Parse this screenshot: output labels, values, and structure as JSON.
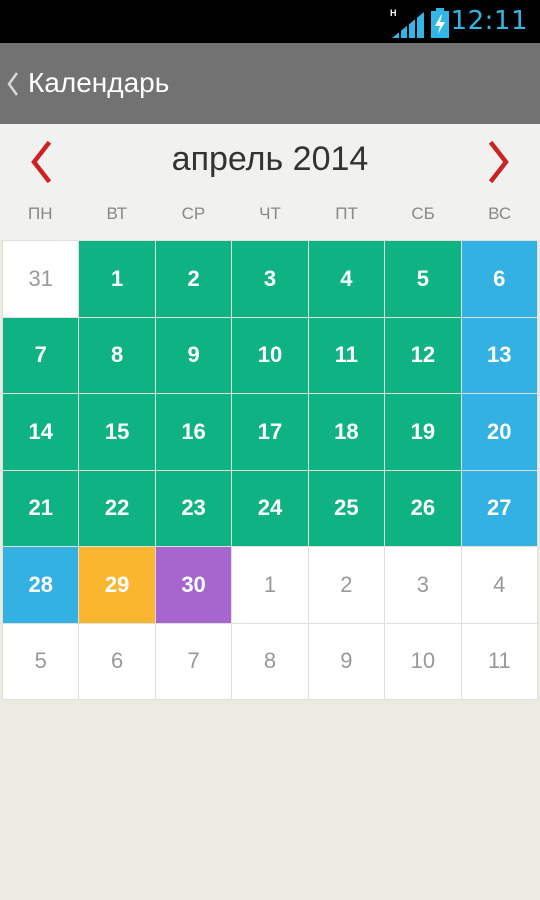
{
  "status_bar": {
    "time": "12:11",
    "network_type": "H",
    "signal_icon": "signal-bars-icon",
    "battery_icon": "battery-charging-icon",
    "accent_color": "#33b5e5"
  },
  "action_bar": {
    "back_icon": "chevron-left-icon",
    "title": "Календарь"
  },
  "calendar": {
    "month_title": "апрель 2014",
    "prev_icon": "chevron-left-icon",
    "next_icon": "chevron-right-icon",
    "nav_color": "#cc2222",
    "weekdays": [
      "ПН",
      "ВТ",
      "СР",
      "ЧТ",
      "ПТ",
      "СБ",
      "ВС"
    ],
    "colors": {
      "green": "#0fb383",
      "blue": "#33b1e2",
      "orange": "#fbb630",
      "purple": "#a766cd",
      "out": "#ffffff"
    },
    "days": [
      {
        "label": "31",
        "style": "out"
      },
      {
        "label": "1",
        "style": "green"
      },
      {
        "label": "2",
        "style": "green"
      },
      {
        "label": "3",
        "style": "green"
      },
      {
        "label": "4",
        "style": "green"
      },
      {
        "label": "5",
        "style": "green"
      },
      {
        "label": "6",
        "style": "blue"
      },
      {
        "label": "7",
        "style": "green"
      },
      {
        "label": "8",
        "style": "green"
      },
      {
        "label": "9",
        "style": "green"
      },
      {
        "label": "10",
        "style": "green"
      },
      {
        "label": "11",
        "style": "green"
      },
      {
        "label": "12",
        "style": "green"
      },
      {
        "label": "13",
        "style": "blue"
      },
      {
        "label": "14",
        "style": "green"
      },
      {
        "label": "15",
        "style": "green"
      },
      {
        "label": "16",
        "style": "green"
      },
      {
        "label": "17",
        "style": "green"
      },
      {
        "label": "18",
        "style": "green"
      },
      {
        "label": "19",
        "style": "green"
      },
      {
        "label": "20",
        "style": "blue"
      },
      {
        "label": "21",
        "style": "green"
      },
      {
        "label": "22",
        "style": "green"
      },
      {
        "label": "23",
        "style": "green"
      },
      {
        "label": "24",
        "style": "green"
      },
      {
        "label": "25",
        "style": "green"
      },
      {
        "label": "26",
        "style": "green"
      },
      {
        "label": "27",
        "style": "blue"
      },
      {
        "label": "28",
        "style": "blue"
      },
      {
        "label": "29",
        "style": "orange"
      },
      {
        "label": "30",
        "style": "purple"
      },
      {
        "label": "1",
        "style": "out"
      },
      {
        "label": "2",
        "style": "out"
      },
      {
        "label": "3",
        "style": "out"
      },
      {
        "label": "4",
        "style": "out"
      },
      {
        "label": "5",
        "style": "out"
      },
      {
        "label": "6",
        "style": "out"
      },
      {
        "label": "7",
        "style": "out"
      },
      {
        "label": "8",
        "style": "out"
      },
      {
        "label": "9",
        "style": "out"
      },
      {
        "label": "10",
        "style": "out"
      },
      {
        "label": "11",
        "style": "out"
      }
    ]
  }
}
